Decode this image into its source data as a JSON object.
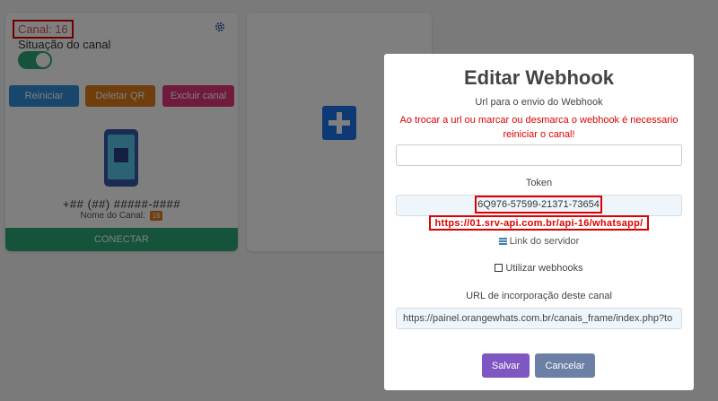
{
  "channel_card": {
    "channel_label": "Canal: 16",
    "status_label": "Situação do canal",
    "buttons": {
      "restart": "Reiniciar",
      "delete_qr": "Deletar QR",
      "delete_channel": "Excluir canal"
    },
    "phone_number": "+## (##) #####-####",
    "channel_name_label": "Nome do Canal:",
    "channel_name_value": "16",
    "connect_label": "CONECTAR",
    "icons": {
      "settings": "gear-icon",
      "phone": "phone-qr-icon"
    },
    "colors": {
      "toggle": "#2aa876",
      "restart": "#2e8fd8",
      "delete_qr": "#e07b1a",
      "delete_channel": "#e0367c",
      "connect": "#2aa876"
    }
  },
  "add_card": {
    "icon": "plus-icon",
    "color": "#1a73e8"
  },
  "modal": {
    "title": "Editar Webhook",
    "url_label": "Url para o envio do Webhook",
    "warning": "Ao trocar a url ou marcar ou desmarca o webhook é necessario reiniciar o canal!",
    "url_value": "",
    "token_label": "Token",
    "token_value": "6Q976-57599-21371-73654",
    "server_url": "https://01.srv-api.com.br/api-16/whatsapp/",
    "server_link_label": "Link do servidor",
    "use_webhooks_label": "Utilizar webhooks",
    "use_webhooks_checked": false,
    "embed_label": "URL de incorporação deste canal",
    "embed_url": "https://painel.orangewhats.com.br/canais_frame/index.php?to",
    "save_label": "Salvar",
    "cancel_label": "Cancelar",
    "colors": {
      "warning": "#e00000",
      "save": "#7e57c2",
      "cancel": "#6c7fa5"
    }
  }
}
